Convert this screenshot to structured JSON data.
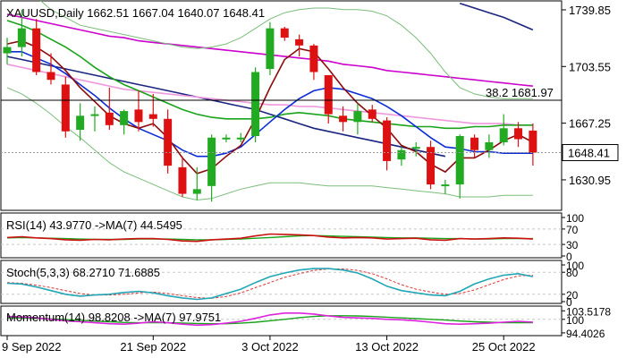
{
  "chart_data": {
    "type": "candlestick",
    "main": {
      "header": "XAUUSD,Daily  1662.51 1667.04 1640.07 1648.41",
      "ylim": [
        1612,
        1745
      ],
      "ticks": [
        {
          "label": "1739.85",
          "value": 1739.85
        },
        {
          "label": "1703.55",
          "value": 1703.55
        },
        {
          "label": "1667.25",
          "value": 1667.25
        },
        {
          "label": "1630.95",
          "value": 1630.95
        }
      ],
      "last_price": {
        "label": "1648.41",
        "value": 1648.41
      },
      "fib_label": "38.2 1681.97",
      "fib_value": 1681.97,
      "candles": [
        {
          "o": 1712,
          "h": 1722,
          "l": 1705,
          "c": 1716
        },
        {
          "o": 1716,
          "h": 1740,
          "l": 1710,
          "c": 1728
        },
        {
          "o": 1728,
          "h": 1734,
          "l": 1698,
          "c": 1700
        },
        {
          "o": 1700,
          "h": 1712,
          "l": 1692,
          "c": 1695
        },
        {
          "o": 1692,
          "h": 1697,
          "l": 1658,
          "c": 1662
        },
        {
          "o": 1663,
          "h": 1680,
          "l": 1656,
          "c": 1672
        },
        {
          "o": 1672,
          "h": 1678,
          "l": 1662,
          "c": 1673
        },
        {
          "o": 1674,
          "h": 1690,
          "l": 1663,
          "c": 1666
        },
        {
          "o": 1666,
          "h": 1676,
          "l": 1660,
          "c": 1675
        },
        {
          "o": 1676,
          "h": 1688,
          "l": 1662,
          "c": 1668
        },
        {
          "o": 1673,
          "h": 1686,
          "l": 1665,
          "c": 1670
        },
        {
          "o": 1670,
          "h": 1676,
          "l": 1635,
          "c": 1640
        },
        {
          "o": 1639,
          "h": 1646,
          "l": 1620,
          "c": 1622
        },
        {
          "o": 1622,
          "h": 1639,
          "l": 1618,
          "c": 1625
        },
        {
          "o": 1627,
          "h": 1660,
          "l": 1617,
          "c": 1658
        },
        {
          "o": 1657,
          "h": 1660,
          "l": 1655,
          "c": 1658
        },
        {
          "o": 1658,
          "h": 1661,
          "l": 1655,
          "c": 1658
        },
        {
          "o": 1659,
          "h": 1703,
          "l": 1655,
          "c": 1700
        },
        {
          "o": 1702,
          "h": 1732,
          "l": 1698,
          "c": 1728
        },
        {
          "o": 1728,
          "h": 1729,
          "l": 1720,
          "c": 1722
        },
        {
          "o": 1721,
          "h": 1724,
          "l": 1710,
          "c": 1717
        },
        {
          "o": 1717,
          "h": 1718,
          "l": 1695,
          "c": 1700
        },
        {
          "o": 1698,
          "h": 1698,
          "l": 1667,
          "c": 1673
        },
        {
          "o": 1672,
          "h": 1678,
          "l": 1662,
          "c": 1668
        },
        {
          "o": 1668,
          "h": 1680,
          "l": 1660,
          "c": 1675
        },
        {
          "o": 1676,
          "h": 1679,
          "l": 1668,
          "c": 1670
        },
        {
          "o": 1669,
          "h": 1671,
          "l": 1637,
          "c": 1643
        },
        {
          "o": 1644,
          "h": 1652,
          "l": 1640,
          "c": 1650
        },
        {
          "o": 1651,
          "h": 1655,
          "l": 1646,
          "c": 1652
        },
        {
          "o": 1652,
          "h": 1656,
          "l": 1625,
          "c": 1628
        },
        {
          "o": 1628,
          "h": 1631,
          "l": 1622,
          "c": 1628
        },
        {
          "o": 1628,
          "h": 1660,
          "l": 1619,
          "c": 1659
        },
        {
          "o": 1658,
          "h": 1660,
          "l": 1645,
          "c": 1650
        },
        {
          "o": 1650,
          "h": 1660,
          "l": 1645,
          "c": 1655
        },
        {
          "o": 1655,
          "h": 1673,
          "l": 1653,
          "c": 1664
        },
        {
          "o": 1664,
          "h": 1668,
          "l": 1652,
          "c": 1657
        },
        {
          "o": 1662.51,
          "h": 1667.04,
          "l": 1640.07,
          "c": 1648.41
        }
      ],
      "overlays": [
        {
          "color": "#1a237e",
          "values": [
            1710,
            1708,
            1706,
            1704,
            1702,
            1700,
            1698,
            1696,
            1694,
            1692,
            1690,
            1688,
            1686,
            1684,
            1682,
            1680,
            1678,
            1676,
            1673,
            1670,
            1667,
            1664,
            1662,
            1660,
            1658,
            1656,
            1654,
            1652,
            1650,
            1648,
            1646,
            1744,
            1741,
            1738,
            1735,
            1731,
            1727
          ],
          "segment_from": 31
        },
        {
          "color": "#cc00cc",
          "values": [
            1737,
            1735,
            1733,
            1731,
            1729,
            1727,
            1725,
            1723,
            1722,
            1720,
            1719,
            1718,
            1717,
            1716,
            1715,
            1714,
            1713,
            1712,
            1711,
            1710,
            1709,
            1708,
            1707,
            1705,
            1704,
            1703,
            1701,
            1700,
            1699,
            1698,
            1697,
            1696,
            1695,
            1694,
            1693,
            1692,
            1691
          ]
        },
        {
          "color": "#ee99dd",
          "values": [
            1705,
            1703,
            1701,
            1699,
            1697,
            1695,
            1693,
            1691,
            1689,
            1688,
            1687,
            1686,
            1685,
            1684,
            1683,
            1682,
            1681,
            1680,
            1679,
            1679,
            1678,
            1678,
            1677,
            1676,
            1675,
            1674,
            1673,
            1672,
            1671,
            1670,
            1669,
            1668,
            1667,
            1667,
            1667,
            1666,
            1666
          ]
        },
        {
          "color": "#1aa31a",
          "values": [
            1733,
            1730,
            1726,
            1721,
            1716,
            1710,
            1703,
            1697,
            1692,
            1688,
            1684,
            1680,
            1676,
            1673,
            1671,
            1670,
            1670,
            1670,
            1671,
            1673,
            1674,
            1673,
            1672,
            1670,
            1669,
            1668,
            1667,
            1666,
            1665,
            1665,
            1664,
            1664,
            1665,
            1665,
            1666,
            1666,
            1666
          ]
        },
        {
          "color": "#0a2cd6",
          "values": [
            1713,
            1713,
            1709,
            1705,
            1699,
            1692,
            1685,
            1677,
            1670,
            1664,
            1660,
            1656,
            1650,
            1646,
            1646,
            1648,
            1652,
            1660,
            1668,
            1676,
            1683,
            1688,
            1690,
            1689,
            1686,
            1683,
            1678,
            1672,
            1665,
            1658,
            1652,
            1651,
            1649,
            1649,
            1648,
            1648,
            1648
          ]
        },
        {
          "color": "#8b0a0a",
          "values": [
            1718,
            1720,
            1716,
            1710,
            1701,
            1690,
            1681,
            1672,
            1667,
            1664,
            1667,
            1658,
            1645,
            1635,
            1638,
            1646,
            1653,
            1670,
            1690,
            1708,
            1715,
            1713,
            1702,
            1690,
            1680,
            1672,
            1664,
            1653,
            1649,
            1641,
            1636,
            1645,
            1645,
            1650,
            1656,
            1660,
            1655
          ]
        },
        {
          "color": "#7bbd7b",
          "values": [
            1760,
            1756,
            1748,
            1740,
            1735,
            1730,
            1728,
            1726,
            1724,
            1722,
            1720,
            1718,
            1716,
            1715,
            1716,
            1718,
            1722,
            1728,
            1734,
            1738,
            1740,
            1741,
            1741,
            1740,
            1740,
            1739,
            1736,
            1730,
            1722,
            1712,
            1700,
            1690,
            1686,
            1684,
            1683,
            1683,
            1683
          ]
        },
        {
          "color": "#7bbd7b",
          "values": [
            1690,
            1686,
            1680,
            1673,
            1665,
            1658,
            1650,
            1642,
            1636,
            1632,
            1628,
            1624,
            1620,
            1618,
            1619,
            1622,
            1625,
            1627,
            1629,
            1629,
            1629,
            1628,
            1627,
            1627,
            1627,
            1627,
            1626,
            1625,
            1624,
            1623,
            1622,
            1620,
            1620,
            1620,
            1621,
            1621,
            1621
          ]
        }
      ]
    },
    "rsi": {
      "header": "RSI(14) 43.9770  ->MA(7) 44.5495",
      "ticks": [
        {
          "label": "100",
          "value": 100
        },
        {
          "label": "70",
          "value": 70
        },
        {
          "label": "30",
          "value": 30
        },
        {
          "label": "0",
          "value": 0
        }
      ],
      "line": [
        48,
        50,
        47,
        45,
        42,
        41,
        43,
        42,
        44,
        45,
        45,
        43,
        39,
        38,
        42,
        44,
        46,
        52,
        57,
        56,
        55,
        53,
        49,
        47,
        48,
        47,
        44,
        45,
        46,
        42,
        41,
        45,
        44,
        45,
        47,
        46,
        44
      ],
      "ma": [
        47,
        48,
        47,
        46,
        45,
        44,
        43,
        43,
        43,
        44,
        44,
        44,
        43,
        42,
        42,
        43,
        44,
        46,
        48,
        50,
        52,
        53,
        52,
        51,
        50,
        49,
        48,
        47,
        47,
        46,
        45,
        45,
        44,
        44,
        45,
        45,
        45
      ]
    },
    "stoch": {
      "header": "Stoch(5,3,3) 68.2710 71.6885",
      "ticks": [
        {
          "label": "100",
          "value": 100
        },
        {
          "label": "80",
          "value": 80
        },
        {
          "label": "20",
          "value": 20
        },
        {
          "label": "0",
          "value": 0
        }
      ],
      "k": [
        50,
        48,
        40,
        30,
        20,
        15,
        18,
        20,
        25,
        28,
        24,
        16,
        10,
        6,
        10,
        22,
        34,
        52,
        68,
        78,
        86,
        90,
        90,
        86,
        78,
        62,
        42,
        30,
        24,
        18,
        16,
        28,
        48,
        62,
        72,
        76,
        68
      ],
      "d": [
        52,
        50,
        45,
        38,
        30,
        22,
        18,
        18,
        20,
        24,
        26,
        22,
        16,
        11,
        9,
        14,
        24,
        38,
        52,
        66,
        76,
        85,
        89,
        89,
        85,
        76,
        62,
        46,
        34,
        26,
        20,
        22,
        32,
        46,
        60,
        70,
        72
      ]
    },
    "momentum": {
      "header": "Momentum(14) 98.8208  ->MA(7) 97.9751",
      "ticks": [
        {
          "label": "103.5178",
          "value": 103.5178
        },
        {
          "label": "100",
          "value": 100
        },
        {
          "label": "94.4026",
          "value": 94.4026
        }
      ],
      "line": [
        101.2,
        101.0,
        100.6,
        100.0,
        99.4,
        99.0,
        98.6,
        98.2,
        98.0,
        98.4,
        99.0,
        98.6,
        98.0,
        97.6,
        97.8,
        98.4,
        99.2,
        100.4,
        101.8,
        102.6,
        102.6,
        102.2,
        101.4,
        100.8,
        100.6,
        100.4,
        100.0,
        99.8,
        99.4,
        98.8,
        98.2,
        98.0,
        98.2,
        98.4,
        98.8,
        99.2,
        98.8
      ],
      "ma": [
        100.6,
        100.6,
        100.4,
        100.2,
        99.9,
        99.6,
        99.3,
        99.0,
        98.7,
        98.6,
        98.6,
        98.6,
        98.5,
        98.3,
        98.2,
        98.2,
        98.4,
        98.8,
        99.4,
        100.0,
        100.7,
        101.2,
        101.5,
        101.5,
        101.4,
        101.2,
        100.9,
        100.6,
        100.3,
        100.0,
        99.7,
        99.3,
        99.0,
        98.8,
        98.6,
        98.6,
        98.6
      ]
    },
    "x_labels": [
      {
        "label": "9 Sep 2022",
        "index": 0
      },
      {
        "label": "21 Sep 2022",
        "index": 10
      },
      {
        "label": "3 Oct 2022",
        "index": 18
      },
      {
        "label": "13 Oct 2022",
        "index": 26
      },
      {
        "label": "25 Oct 2022",
        "index": 34
      }
    ],
    "colors": {
      "bull": "#22aa22",
      "bear": "#dd1111",
      "grid": "#bbbbbb",
      "axis": "#000000"
    }
  }
}
